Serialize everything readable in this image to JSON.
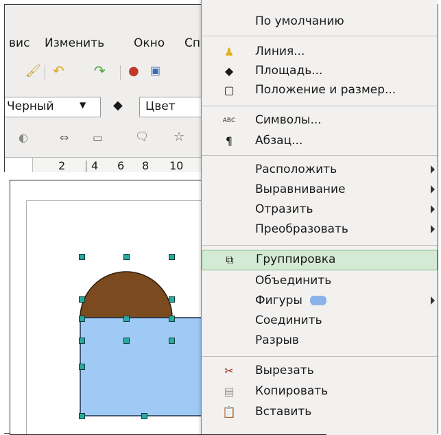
{
  "menubar": {
    "items": [
      "вис",
      "Изменить",
      "Окно",
      "Сп"
    ]
  },
  "toolbar2": {
    "color_value": "Черный",
    "fill_value": "Цвет"
  },
  "ruler": {
    "ticks": [
      "2",
      "4",
      "6",
      "8",
      "10"
    ]
  },
  "menu": {
    "default": "По умолчанию",
    "line": "Линия...",
    "area": "Площадь...",
    "position_size": "Положение и размер...",
    "symbols": "Символы...",
    "paragraph": "Абзац...",
    "arrange": "Расположить",
    "align": "Выравнивание",
    "flip": "Отразить",
    "convert": "Преобразовать",
    "group": "Группировка",
    "combine": "Объединить",
    "shapes": "Фигуры",
    "connect": "Соединить",
    "break": "Разрыв",
    "cut": "Вырезать",
    "copy": "Копировать",
    "paste": "Вставить"
  },
  "colors": {
    "semicircle": "#7b4a1e",
    "rectangle": "#9fcaf5",
    "highlight": "#d3ead5"
  }
}
